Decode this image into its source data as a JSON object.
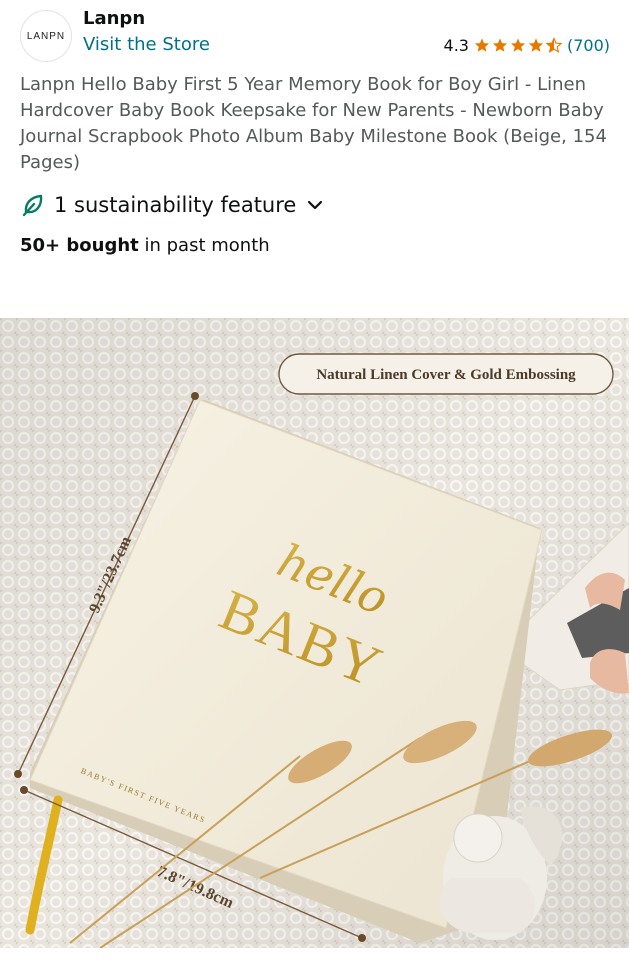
{
  "store": {
    "logo_text": "LANPN",
    "brand": "Lanpn",
    "visit_label": "Visit the Store"
  },
  "rating": {
    "value": "4.3",
    "stars": 4.3,
    "count": "(700)",
    "star_color": "#e67a00"
  },
  "product": {
    "title": "Lanpn Hello Baby First 5 Year Memory Book for Boy Girl - Linen Hardcover Baby Book Keepsake for New Parents - Newborn Baby Journal Scrapbook Photo Album Baby Milestone Book (Beige, 154 Pages)"
  },
  "sustainability": {
    "label": "1 sustainability feature",
    "icon": "leaf-icon",
    "color": "#067d62"
  },
  "purchases": {
    "count": "50+ bought",
    "suffix": " in past month"
  },
  "image": {
    "badge": "Natural Linen Cover & Gold Embossing",
    "cover_script": "hello",
    "cover_title": "BABY",
    "spine_text": "BABY'S FIRST FIVE YEARS",
    "height_label": "9.3\"/23.7cm",
    "width_label": "7.8\"/19.8cm"
  }
}
